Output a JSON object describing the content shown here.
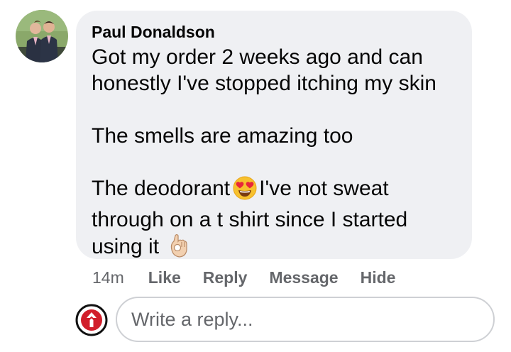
{
  "comment": {
    "author": "Paul Donaldson",
    "lines": [
      "Got my order 2 weeks ago and can",
      "honestly I've stopped itching my skin",
      "The smells are amazing too",
      "The deodorant",
      "I've not sweat",
      "through on a t shirt since I started",
      "using it"
    ],
    "emojis": [
      "heart-eyes-emoji",
      "ok-hand-emoji"
    ]
  },
  "actions": {
    "time": "14m",
    "like": "Like",
    "reply": "Reply",
    "message": "Message",
    "hide": "Hide"
  },
  "reply_input": {
    "placeholder": "Write a reply...",
    "value": ""
  },
  "colors": {
    "bubble_bg": "#eff0f3",
    "meta_text": "#65676b",
    "body_text": "#050505",
    "input_border": "#ced0d4",
    "page_avatar_red": "#d11f2b"
  }
}
